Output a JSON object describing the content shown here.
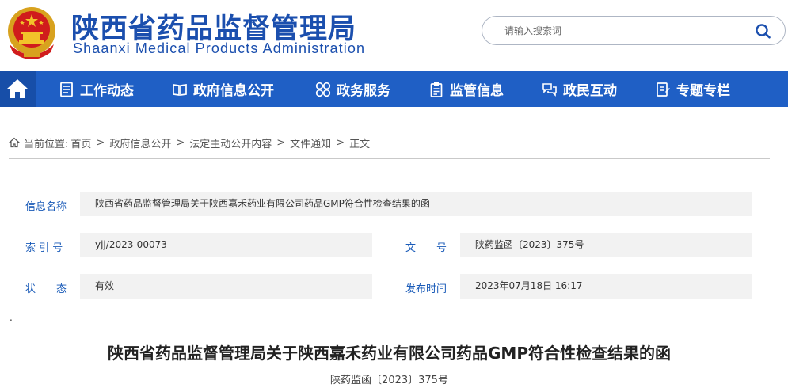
{
  "header": {
    "title": "陕西省药品监督管理局",
    "subtitle": "Shaanxi Medical Products Administration",
    "search": {
      "placeholder": "请输入搜索词"
    },
    "emblem_icon": "national-emblem-icon"
  },
  "nav": {
    "home_icon": "home-icon",
    "items": [
      {
        "label": "工作动态",
        "icon": "document-list-icon"
      },
      {
        "label": "政府信息公开",
        "icon": "open-book-icon"
      },
      {
        "label": "政务服务",
        "icon": "services-grid-icon"
      },
      {
        "label": "监管信息",
        "icon": "clipboard-icon"
      },
      {
        "label": "政民互动",
        "icon": "chat-bubbles-icon"
      },
      {
        "label": "专题专栏",
        "icon": "special-topic-icon"
      }
    ]
  },
  "breadcrumb": {
    "prefix": "当前位置:",
    "items": [
      "首页",
      "政府信息公开",
      "法定主动公开内容",
      "文件通知",
      "正文"
    ],
    "separator": ">"
  },
  "info": {
    "name_label": "信息名称",
    "name_value": "陕西省药品监督管理局关于陕西嘉禾药业有限公司药品GMP符合性检查结果的函",
    "index_label": "索 引 号",
    "index_value": "yjj/2023-00073",
    "docno_label": "文　　号",
    "docno_value": "陕药监函〔2023〕375号",
    "status_label": "状　　态",
    "status_value": "有效",
    "date_label": "发布时间",
    "date_value": "2023年07月18日 16:17"
  },
  "article": {
    "dot": ".",
    "title": "陕西省药品监督管理局关于陕西嘉禾药业有限公司药品GMP符合性检查结果的函",
    "doc_number": "陕药监函〔2023〕375号"
  },
  "colors": {
    "brand_blue": "#1b4fae",
    "nav_bg": "#1f5fc5",
    "label_blue": "#1a5bb8",
    "value_bg": "#f2f2f2"
  }
}
